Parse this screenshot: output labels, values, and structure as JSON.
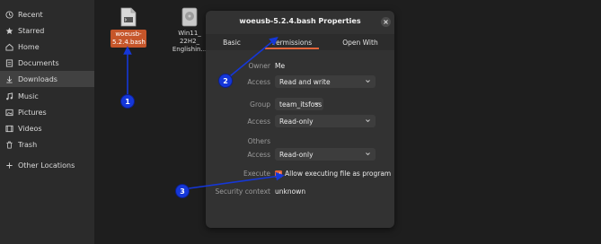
{
  "sidebar": {
    "items": [
      {
        "label": "Recent",
        "icon": "clock-icon"
      },
      {
        "label": "Starred",
        "icon": "star-icon"
      },
      {
        "label": "Home",
        "icon": "home-icon"
      },
      {
        "label": "Documents",
        "icon": "document-icon"
      },
      {
        "label": "Downloads",
        "icon": "download-icon",
        "active": true
      },
      {
        "label": "Music",
        "icon": "music-icon"
      },
      {
        "label": "Pictures",
        "icon": "picture-icon"
      },
      {
        "label": "Videos",
        "icon": "video-icon"
      },
      {
        "label": "Trash",
        "icon": "trash-icon"
      },
      {
        "label": "Other Locations",
        "icon": "plus-icon"
      }
    ]
  },
  "files": {
    "items": [
      {
        "label_line1": "woeusb-",
        "label_line2": "5.2.4.bash",
        "icon": "script-file-icon",
        "selected": true
      },
      {
        "label_line1": "Win11_",
        "label_line2": "22H2_",
        "label_line3": "Englishin...",
        "icon": "disc-image-icon"
      }
    ]
  },
  "dialog": {
    "title": "woeusb-5.2.4.bash Properties",
    "tabs": [
      {
        "label": "Basic"
      },
      {
        "label": "Permissions",
        "active": true
      },
      {
        "label": "Open With"
      }
    ],
    "owner": {
      "label": "Owner",
      "value": "Me"
    },
    "owner_access": {
      "label": "Access",
      "value": "Read and write"
    },
    "group": {
      "label": "Group",
      "value": "team_itsfoss"
    },
    "group_access": {
      "label": "Access",
      "value": "Read-only"
    },
    "others": {
      "label": "Others"
    },
    "others_access": {
      "label": "Access",
      "value": "Read-only"
    },
    "execute": {
      "label": "Execute",
      "checkbox_label": "Allow executing file as program",
      "checked": true
    },
    "security": {
      "label": "Security context",
      "value": "unknown"
    }
  },
  "annotations": {
    "badges": [
      "1",
      "2",
      "3"
    ],
    "color": "#1537d8"
  },
  "colors": {
    "accent": "#e2653a",
    "selection": "#c6562a"
  }
}
